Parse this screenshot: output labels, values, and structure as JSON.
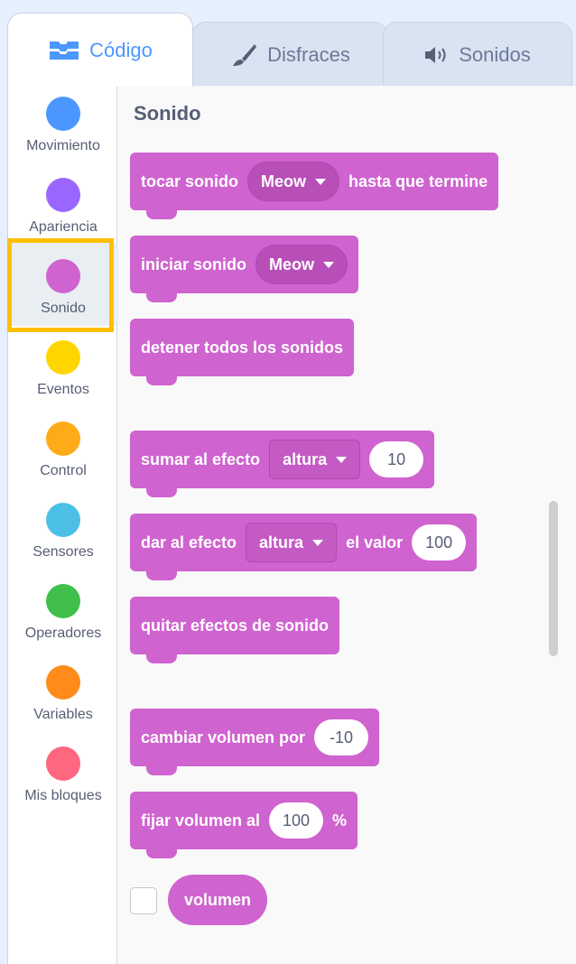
{
  "tabs": {
    "code": "Código",
    "costumes": "Disfraces",
    "sounds": "Sonidos"
  },
  "categories": [
    {
      "label": "Movimiento",
      "color": "#4c97ff"
    },
    {
      "label": "Apariencia",
      "color": "#9966ff"
    },
    {
      "label": "Sonido",
      "color": "#cf63cf"
    },
    {
      "label": "Eventos",
      "color": "#ffd500"
    },
    {
      "label": "Control",
      "color": "#ffab19"
    },
    {
      "label": "Sensores",
      "color": "#4cbfe6"
    },
    {
      "label": "Operadores",
      "color": "#40bf4a"
    },
    {
      "label": "Variables",
      "color": "#ff8c1a"
    },
    {
      "label": "Mis bloques",
      "color": "#ff6680"
    }
  ],
  "selected_category": "Sonido",
  "palette": {
    "title": "Sonido",
    "blocks": {
      "play_until_done": {
        "text1": "tocar sonido",
        "dropdown": "Meow",
        "text2": "hasta que termine"
      },
      "start_sound": {
        "text1": "iniciar sonido",
        "dropdown": "Meow"
      },
      "stop_all": {
        "text1": "detener todos los sonidos"
      },
      "change_effect": {
        "text1": "sumar al efecto",
        "dropdown": "altura",
        "value": "10"
      },
      "set_effect": {
        "text1": "dar al efecto",
        "dropdown": "altura",
        "text2": "el valor",
        "value": "100"
      },
      "clear_effects": {
        "text1": "quitar efectos de sonido"
      },
      "change_volume": {
        "text1": "cambiar volumen por",
        "value": "-10"
      },
      "set_volume": {
        "text1": "fijar volumen al",
        "value": "100",
        "unit": "%"
      },
      "volume_reporter": {
        "text1": "volumen"
      }
    }
  },
  "colors": {
    "sound_block": "#cf63cf",
    "highlight": "#ffbf00",
    "active_tab_text": "#4c97ff"
  },
  "icons": {
    "code_tab": "code-blocks-icon",
    "costumes_tab": "paintbrush-icon",
    "sounds_tab": "speaker-icon"
  }
}
